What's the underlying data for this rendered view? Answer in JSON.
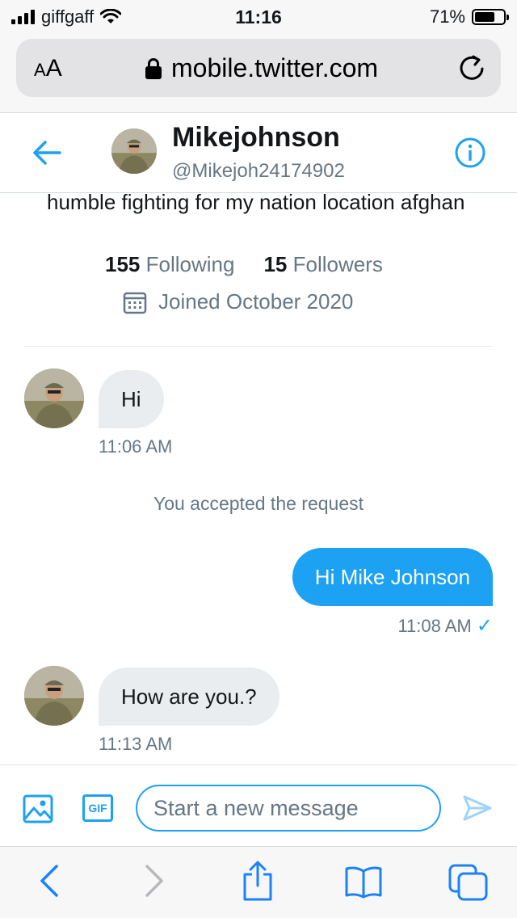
{
  "status_bar": {
    "carrier": "giffgaff",
    "time": "11:16",
    "battery_text": "71%",
    "battery_level": 0.71,
    "icons": [
      "signal-icon",
      "wifi-icon",
      "battery-icon"
    ]
  },
  "browser": {
    "text_size_label_small": "A",
    "text_size_label_large": "A",
    "url": "mobile.twitter.com",
    "icons": [
      "lock-icon",
      "reload-icon"
    ]
  },
  "dm_header": {
    "name": "Mikejohnson",
    "handle": "@Mikejoh24174902",
    "icons": [
      "back-arrow-icon",
      "info-icon"
    ]
  },
  "profile_summary": {
    "bio": "humble fighting for my nation location afghan",
    "following_count": "155",
    "following_label": "Following",
    "followers_count": "15",
    "followers_label": "Followers",
    "joined": "Joined October 2020"
  },
  "messages": [
    {
      "direction": "incoming",
      "text": "Hi",
      "time": "11:06 AM"
    },
    {
      "direction": "outgoing",
      "text": "Hi Mike Johnson",
      "time": "11:08 AM",
      "read_check": "✓"
    },
    {
      "direction": "incoming",
      "text": "How are you.?",
      "time": "11:13 AM"
    }
  ],
  "system_message": "You accepted the request",
  "composer": {
    "placeholder": "Start a new message",
    "gif_label": "GIF",
    "icons": [
      "image-icon",
      "gif-icon",
      "send-icon"
    ]
  },
  "toolbar": {
    "icons": [
      "back-icon",
      "forward-icon",
      "share-icon",
      "bookmarks-icon",
      "tabs-icon"
    ]
  },
  "colors": {
    "accent": "#1da1f2",
    "secondary_text": "#657786",
    "incoming_bubble": "#e9edf0"
  }
}
